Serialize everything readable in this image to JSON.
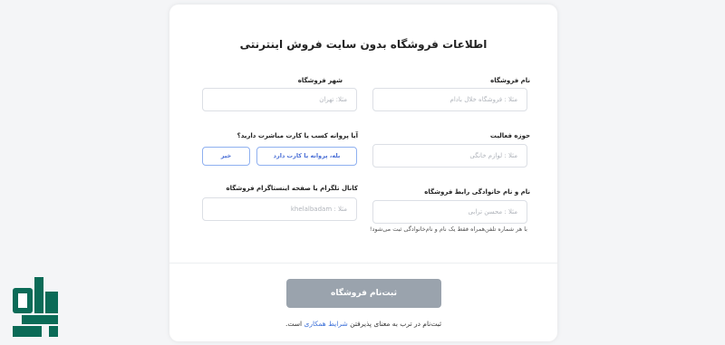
{
  "form": {
    "title": "اطلاعات فروشگاه بدون سایت فروش اینترنتی",
    "store_name": {
      "label": "نام فروشگاه",
      "placeholder": "مثلا : فروشگاه خلال بادام"
    },
    "city": {
      "label": "شهر فروشگاه",
      "placeholder": "مثلا: تهران"
    },
    "activity": {
      "label": "حوزه فعالیت",
      "placeholder": "مثلا : لوازم خانگی"
    },
    "license": {
      "question": "آیا پروانه کسب یا کارت مباشرت دارید؟",
      "yes_label": "بله، پروانه یا کارت دارد",
      "no_label": "خیر"
    },
    "contact": {
      "label": "نام و نام خانوادگی رابط فروشگاه",
      "placeholder": "مثلا : محسن ترابی",
      "hint": "با هر شماره تلفن‌همراه فقط یک نام و نام‌خانوادگی ثبت می‌شود!"
    },
    "channel": {
      "label": "کانال تلگرام یا صفحه اینستاگرام فروشگاه",
      "placeholder": "مثلا : khelalbadam"
    },
    "submit_label": "ثبت‌نام فروشگاه",
    "terms_prefix": "ثبت‌نام در ترب به معنای پذیرفتن",
    "terms_link": "شرایط همکاری",
    "terms_suffix": "است."
  },
  "colors": {
    "accent": "#3b6fd8",
    "submit_bg": "#9aa3ad",
    "logo_green": "#0b6b57"
  }
}
